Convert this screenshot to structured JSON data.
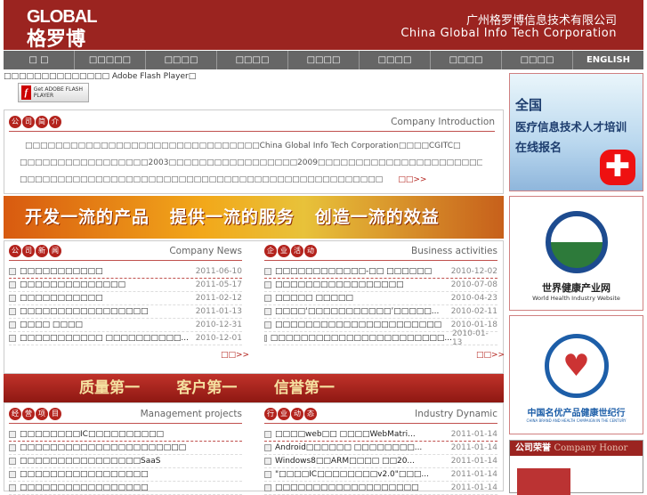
{
  "header": {
    "logo_en": "GLOBAL",
    "logo_cn": "格罗博",
    "company_cn": "广州格罗博信息技术有限公司",
    "company_en": "China Global Info Tech Corporation"
  },
  "nav": [
    "□ □",
    "□□□□□",
    "□□□□",
    "□□□□",
    "□□□□",
    "□□□□",
    "□□□□",
    "□□□□",
    "ENGLISH"
  ],
  "flash": {
    "message": "□□□□□□□□□□□□□□ Adobe Flash Player□",
    "button": "Get ADOBE FLASH PLAYER"
  },
  "intro": {
    "title_cn": [
      "公",
      "司",
      "简",
      "介"
    ],
    "title_en": "Company Introduction",
    "lines": [
      "□□□□□□□□□□□□□□□□□□□□□□□□□□□□□□□China Global Info Tech Corporation□□□□CGITC□",
      "□□□□□□□□□□□□□□□□□2003□□□□□□□□□□□□□□□□□2009□□□□□□□□□□□□□□□□□□□□□□□□□□□□□□□□□□",
      "□□□□□□□□□□□□□□□□□□□□□□□□□□□□□□□□□□□□□□□□□□□□□□□□"
    ],
    "more": "□□>>"
  },
  "banner1": "开发一流的产品   提供一流的服务   创造一流的效益",
  "banner2": "质量第一       客户第一       信誉第一",
  "company_news": {
    "title_cn": [
      "公",
      "司",
      "新",
      "闻"
    ],
    "title_en": "Company News",
    "more": "□□>>",
    "items": [
      {
        "t": "□□□□□□□□□□□",
        "d": "2011-06-10"
      },
      {
        "t": "□□□□□□□□□□□□□□",
        "d": "2011-05-17"
      },
      {
        "t": "□□□□□□□□□□□",
        "d": "2011-02-12"
      },
      {
        "t": "□□□□□□□□□□□□□□□□□",
        "d": "2011-01-13"
      },
      {
        "t": "□□□□ □□□□",
        "d": "2010-12-31"
      },
      {
        "t": "□□□□□□□□□□□ □□□□□□□□□□...",
        "d": "2010-12-01"
      }
    ]
  },
  "business": {
    "title_cn": [
      "企",
      "业",
      "活",
      "动"
    ],
    "title_en": "Business activities",
    "more": "□□>>",
    "items": [
      {
        "t": "□□□□□□□□□□□□-□□ □□□□□□",
        "d": "2010-12-02"
      },
      {
        "t": "□□□□□□□□□□□□□□□□□",
        "d": "2010-07-08"
      },
      {
        "t": "□□□□□ □□□□□",
        "d": "2010-04-23"
      },
      {
        "t": "□□□□‘□□□□□□□□□□□’□□□□□...",
        "d": "2010-02-11"
      },
      {
        "t": "□□□□□□□□□□□□□□□□□□□□□□",
        "d": "2010-01-18"
      },
      {
        "t": "□□□□□□□□□□□□□□□□□□□□□□□...",
        "d": "2010-01-13"
      }
    ]
  },
  "management": {
    "title_cn": [
      "经",
      "营",
      "项",
      "目"
    ],
    "title_en": "Management projects",
    "items": [
      {
        "t": "□□□□□□□□IC□□□□□□□□□□"
      },
      {
        "t": "□□□□□□□□□□□□□□□□□□□□□□"
      },
      {
        "t": "□□□□□□□□□□□□□□□□SaaS"
      },
      {
        "t": "□□□□□□□□□□□□□□□□□"
      },
      {
        "t": "□□□□□□□□□□□□□□□□□"
      }
    ]
  },
  "industry": {
    "title_cn": [
      "行",
      "业",
      "动",
      "态"
    ],
    "title_en": "Industry Dynamic",
    "items": [
      {
        "t": "□□□□web□□ □□□□WebMatri...",
        "d": "2011-01-14"
      },
      {
        "t": "Android□□□□□□ □□□□□□□□...",
        "d": "2011-01-14"
      },
      {
        "t": "Windows8□□ARM□□□□ □□20...",
        "d": "2011-01-14"
      },
      {
        "t": "\"□□□□IC□□□□□□□□v2.0\"□□□...",
        "d": "2011-01-14"
      },
      {
        "t": "□□□□□□□□□□□□□□□□□□□",
        "d": "2011-01-14"
      }
    ]
  },
  "sidebar": {
    "ad1_line1": "全国",
    "ad1_line2": "医疗信息技术人才培训",
    "ad1_line3": "在线报名",
    "ad2_cn": "世界健康产业网",
    "ad2_en": "World Health Industry Website",
    "ad3_cn": "中国名优产品健康世纪行",
    "ad3_en": "CHINA BRAND AND HEALTH CAMPAIGN IN THE CENTURY",
    "honor_cn": "公司荣誉",
    "honor_en": "Company Honor"
  }
}
